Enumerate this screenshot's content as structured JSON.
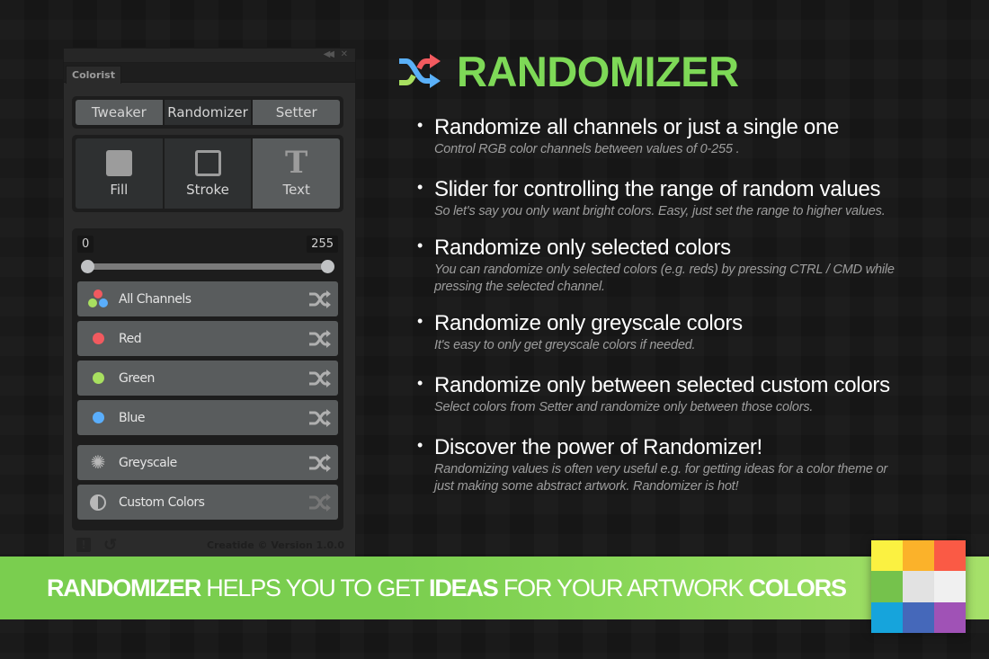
{
  "panel": {
    "tab_label": "Colorist",
    "collapse_glyph": "◀◀",
    "close_glyph": "✕",
    "modes": [
      {
        "label": "Tweaker",
        "active": false
      },
      {
        "label": "Randomizer",
        "active": true
      },
      {
        "label": "Setter",
        "active": false
      }
    ],
    "targets": [
      {
        "label": "Fill",
        "icon": "fill-icon",
        "active": false
      },
      {
        "label": "Stroke",
        "icon": "stroke-icon",
        "active": false
      },
      {
        "label": "Text",
        "icon": "text-icon",
        "active": true
      }
    ],
    "range": {
      "min_label": "0",
      "max_label": "255",
      "low": 0,
      "high": 255,
      "scale_max": 255
    },
    "channels": [
      {
        "label": "All Channels",
        "icon": "rgb-dots-icon"
      },
      {
        "label": "Red",
        "icon": "red-dot-icon",
        "color": "#f25a5f"
      },
      {
        "label": "Green",
        "icon": "green-dot-icon",
        "color": "#a8e060"
      },
      {
        "label": "Blue",
        "icon": "blue-dot-icon",
        "color": "#5aaefc"
      },
      {
        "label": "Greyscale",
        "icon": "sun-icon"
      },
      {
        "label": "Custom Colors",
        "icon": "contrast-icon",
        "disabled_shuffle": true
      }
    ],
    "footer": {
      "credit": "Creatide © Version 1.0.0"
    }
  },
  "heading": {
    "title": "RANDOMIZER",
    "accent_color": "#7ed957"
  },
  "features": [
    {
      "title": "Randomize all channels or just a single one",
      "desc": "Control RGB color channels between values of 0-255 ."
    },
    {
      "title": "Slider for controlling the range of random values",
      "desc": "So let's say you only want bright colors. Easy, just set the range to higher values."
    },
    {
      "title": "Randomize only selected colors",
      "desc": "You can randomize only selected colors (e.g. reds) by pressing CTRL / CMD while pressing the selected channel."
    },
    {
      "title": "Randomize only greyscale colors",
      "desc": "It's easy to only get greyscale colors if needed."
    },
    {
      "title": "Randomize only between selected custom colors",
      "desc": "Select colors from Setter and randomize only between those colors."
    },
    {
      "title": "Discover the power of Randomizer!",
      "desc": "Randomizing values is often very useful e.g. for getting ideas for a color theme or just making some abstract artwork. Randomizer is hot!"
    }
  ],
  "banner": {
    "parts": [
      {
        "text": "RANDOMIZER",
        "bold": true
      },
      {
        "text": " HELPS YOU TO GET ",
        "bold": false
      },
      {
        "text": "IDEAS",
        "bold": true
      },
      {
        "text": " FOR YOUR ARTWORK ",
        "bold": false
      },
      {
        "text": "COLORS",
        "bold": true
      }
    ]
  },
  "swatches": [
    "#fbf141",
    "#fbb22a",
    "#fa5a45",
    "#75c24c",
    "#e2e2e2",
    "#f0f0f0",
    "#16a4dc",
    "#4568ba",
    "#a052b6"
  ]
}
